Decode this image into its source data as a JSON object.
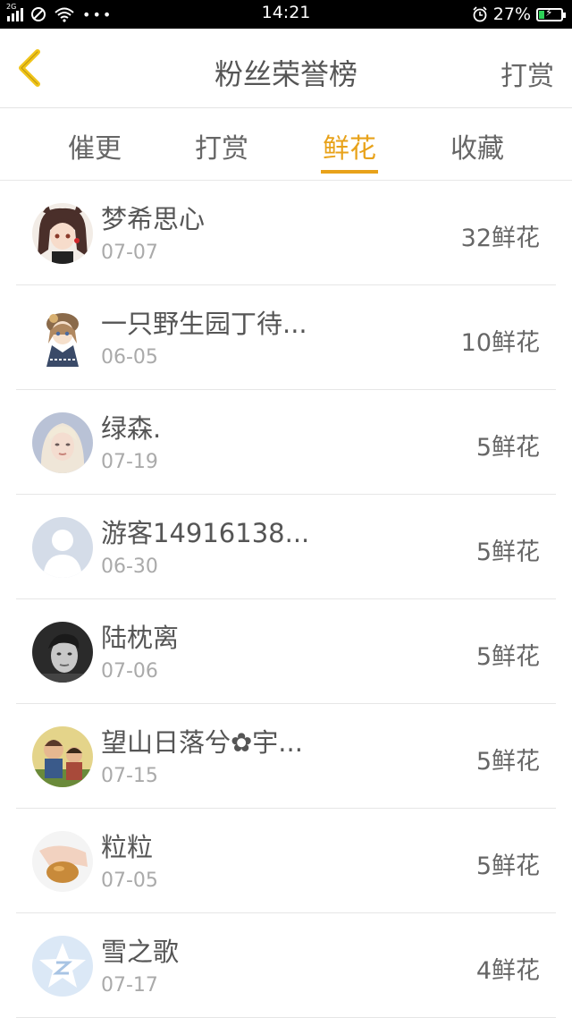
{
  "status_bar": {
    "network": "2G",
    "time": "14:21",
    "battery": "27%",
    "battery_level": 0.27
  },
  "header": {
    "title": "粉丝荣誉榜",
    "action_label": "打赏"
  },
  "tabs": [
    {
      "label": "催更",
      "active": false
    },
    {
      "label": "打赏",
      "active": false
    },
    {
      "label": "鲜花",
      "active": true
    },
    {
      "label": "收藏",
      "active": false
    }
  ],
  "fans": [
    {
      "name": "梦希思心",
      "date": "07-07",
      "amount": "32鲜花",
      "avatar": "anime-girl-avatar"
    },
    {
      "name": "一只野生园丁待...",
      "date": "06-05",
      "amount": "10鲜花",
      "avatar": "anime-doll-avatar"
    },
    {
      "name": "绿森.",
      "date": "07-19",
      "amount": "5鲜花",
      "avatar": "blonde-photo-avatar"
    },
    {
      "name": "游客14916138...",
      "date": "06-30",
      "amount": "5鲜花",
      "avatar": "default-person-avatar"
    },
    {
      "name": "陆枕离",
      "date": "07-06",
      "amount": "5鲜花",
      "avatar": "grayscale-portrait-avatar"
    },
    {
      "name": "望山日落兮✿宇...",
      "date": "07-15",
      "amount": "5鲜花",
      "avatar": "cartoon-kids-avatar"
    },
    {
      "name": "粒粒",
      "date": "07-05",
      "amount": "5鲜花",
      "avatar": "hand-bread-avatar"
    },
    {
      "name": "雪之歌",
      "date": "07-17",
      "amount": "4鲜花",
      "avatar": "qq-star-avatar"
    }
  ],
  "colors": {
    "accent": "#e8a21a",
    "back_arrow": "#f0c419",
    "status_bar_bg": "#000000",
    "battery_fill": "#2ed158"
  }
}
